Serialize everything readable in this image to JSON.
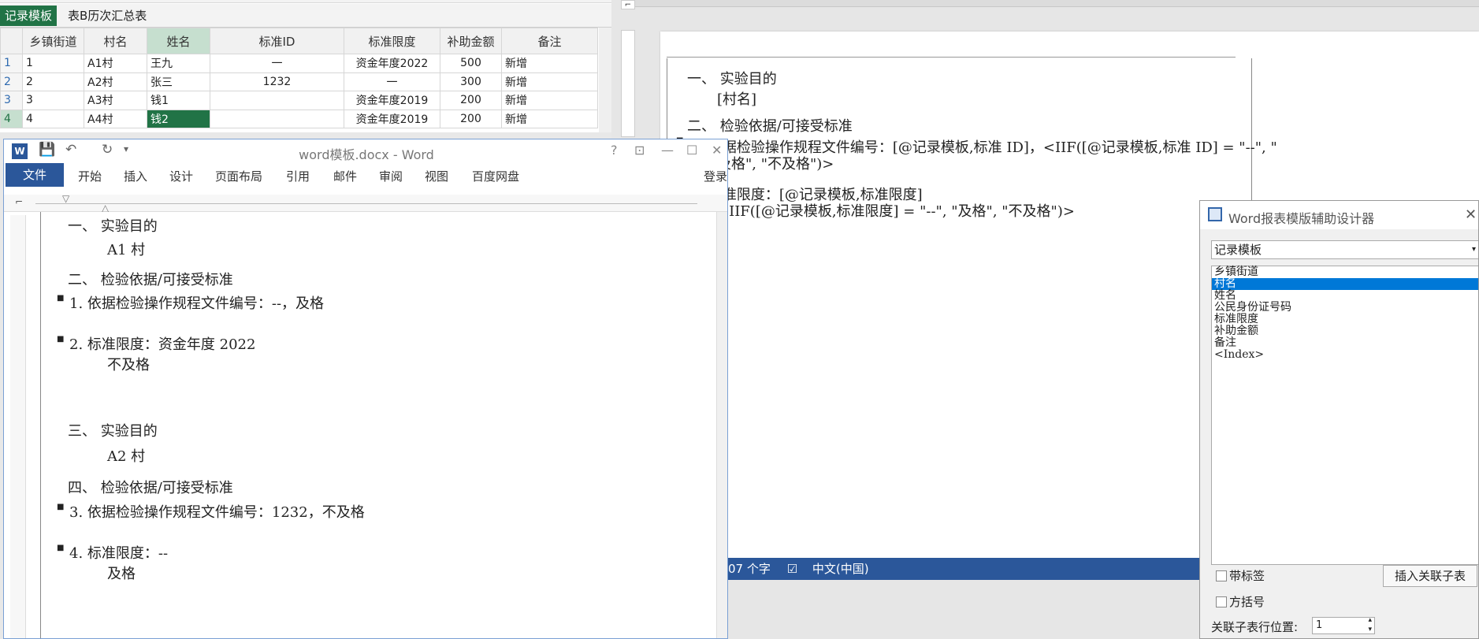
{
  "sheet": {
    "tabs": [
      "记录模板",
      "表B历次汇总表"
    ],
    "headers": [
      "乡镇街道",
      "村名",
      "姓名",
      "标准ID",
      "标准限度",
      "补助金额",
      "备注"
    ],
    "rows": [
      {
        "n": "1",
        "cells": [
          "1",
          "A1村",
          "王九",
          "一",
          "资金年度2022",
          "500",
          "新增"
        ]
      },
      {
        "n": "2",
        "cells": [
          "2",
          "A2村",
          "张三",
          "1232",
          "一",
          "300",
          "新增"
        ]
      },
      {
        "n": "3",
        "cells": [
          "3",
          "A3村",
          "钱1",
          "",
          "资金年度2019",
          "200",
          "新增"
        ]
      },
      {
        "n": "4",
        "cells": [
          "4",
          "A4村",
          "钱2",
          "",
          "资金年度2019",
          "200",
          "新增"
        ]
      }
    ]
  },
  "word": {
    "title": "word模板.docx - Word",
    "controls": [
      "?",
      "⊡",
      "—",
      "☐",
      "✕"
    ],
    "menus": [
      "文件",
      "开始",
      "插入",
      "设计",
      "页面布局",
      "引用",
      "邮件",
      "审阅",
      "视图",
      "百度网盘"
    ],
    "login": "登录",
    "lines": [
      "一、   实验目的",
      "A1 村",
      "二、   检验依据/可接受标准",
      "1.     依据检验操作规程文件编号：--，及格",
      "2.     标准限度：资金年度 2022",
      "不及格",
      "三、   实验目的",
      "A2 村",
      "四、   检验依据/可接受标准",
      "3.     依据检验操作规程文件编号：1232，不及格",
      "4.     标准限度：--",
      "及格"
    ]
  },
  "bgword": {
    "lines": [
      "一、   实验目的",
      "[村名]",
      "二、   检验依据/可接受标准",
      "1.     依据检验操作规程文件编号：[@记录模板,标准 ID]，<IIF([@记录模板,标准 ID] = \"--\", \"",
      "及格\", \"不及格\")>",
      "2.     标准限度：[@记录模板,标准限度]",
      "<IIF([@记录模板,标准限度] = \"--\", \"及格\", \"不及格\")>"
    ],
    "status_words": "07 个字",
    "status_lang": "中文(中国)"
  },
  "dialog": {
    "title": "Word报表模版辅助设计器",
    "combo": "记录模板",
    "fields": [
      "乡镇街道",
      "村名",
      "姓名",
      "公民身份证号码",
      "标准限度",
      "补助金额",
      "备注",
      "<Index>"
    ],
    "selected_index": 1,
    "cb_label": "带标签",
    "cb_bracket": "方括号",
    "insert_btn": "插入关联子表",
    "pos_label": "关联子表行位置:",
    "pos_value": "1"
  }
}
